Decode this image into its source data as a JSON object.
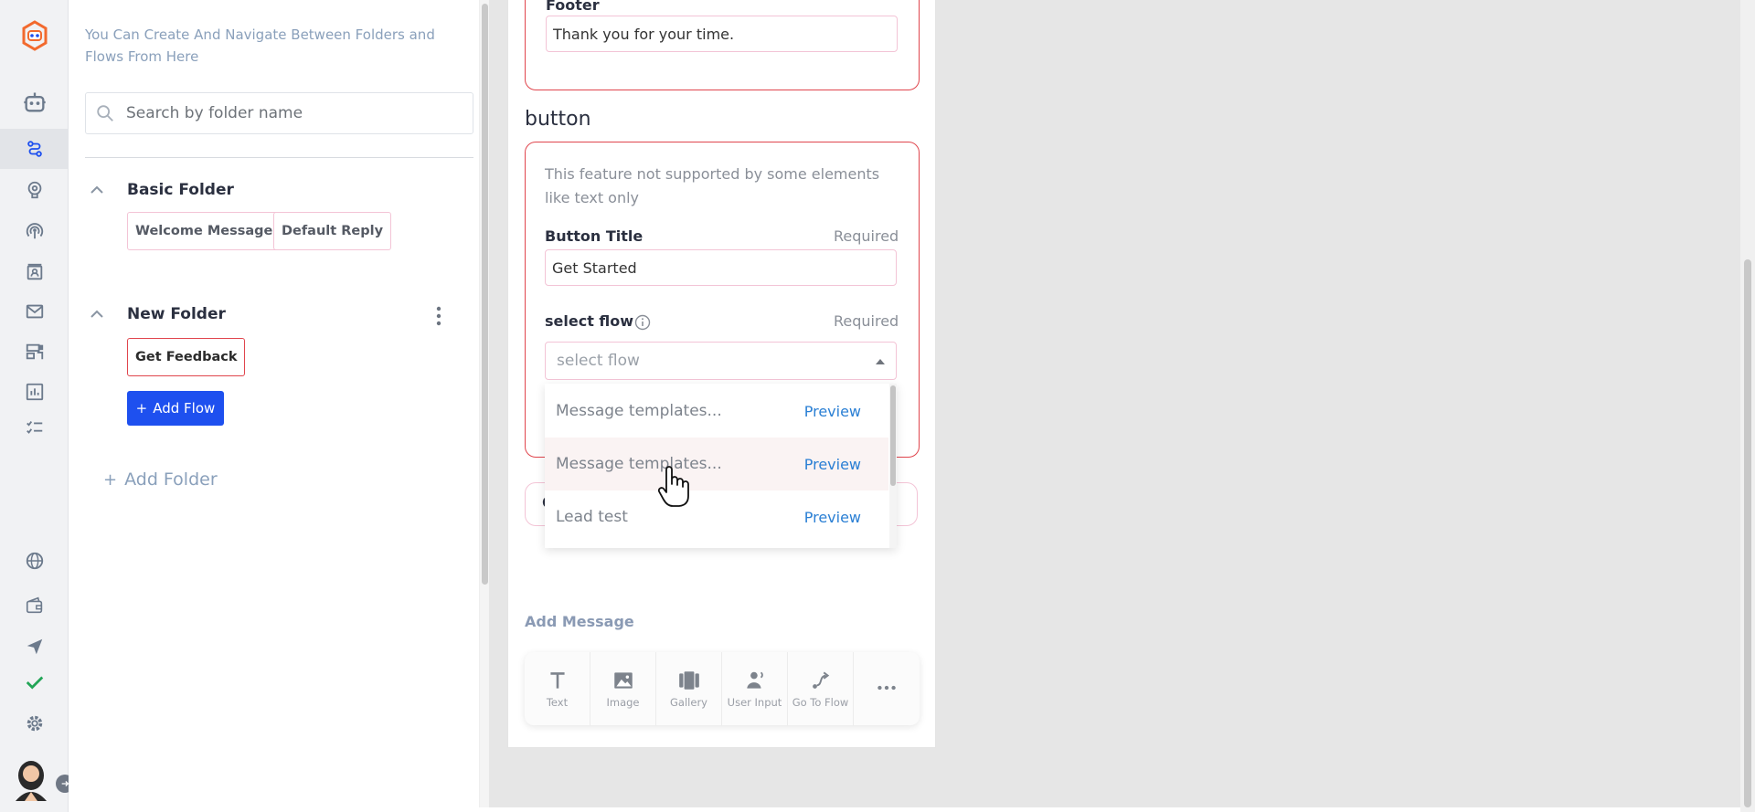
{
  "sidebar": {
    "icons": [
      "app-logo",
      "bot-icon",
      "flows-icon",
      "brain-icon",
      "broadcast-icon",
      "contacts-icon",
      "mail-icon",
      "templates-icon",
      "analytics-icon",
      "checklist-icon",
      "globe-icon",
      "wallet-icon",
      "send-icon",
      "check-icon",
      "settings-icon"
    ],
    "active": "flows-icon"
  },
  "folders": {
    "hint": "You Can Create And Navigate Between Folders and Flows From Here",
    "search_placeholder": "Search by folder name",
    "list": [
      {
        "name": "Basic Folder",
        "flows": [
          "Welcome Message",
          "Default Reply"
        ]
      },
      {
        "name": "New Folder",
        "flows": [
          "Get Feedback"
        ],
        "selected_flow": "Get Feedback"
      }
    ],
    "add_flow_label": "Add Flow",
    "add_flow_plus": "+",
    "add_folder_label": "Add Folder",
    "add_folder_plus": "+"
  },
  "editor": {
    "footer_label": "Footer",
    "footer_value": "Thank you for your time.",
    "button_heading": "button",
    "button_note": "This feature not supported by some elements like text only",
    "button_title_label": "Button Title",
    "required_label": "Required",
    "button_title_value": "Get Started",
    "select_flow_label": "select flow",
    "select_flow_placeholder": "select flow",
    "dropdown_options": [
      {
        "name": "Message templates...",
        "action": "Preview"
      },
      {
        "name": "Message templates...",
        "action": "Preview"
      },
      {
        "name": "Lead test",
        "action": "Preview"
      }
    ],
    "hidden_behind_char": "C",
    "add_message_label": "Add Message",
    "toolbar": [
      {
        "icon": "text-icon",
        "label": "Text"
      },
      {
        "icon": "image-icon",
        "label": "Image"
      },
      {
        "icon": "gallery-icon",
        "label": "Gallery"
      },
      {
        "icon": "user-input-icon",
        "label": "User Input"
      },
      {
        "icon": "go-to-flow-icon",
        "label": "Go To Flow"
      },
      {
        "icon": "more-icon",
        "label": ""
      }
    ]
  },
  "colors": {
    "accent_red": "#e0454d",
    "primary_blue": "#1e50ef",
    "link_blue": "#2a7fd4",
    "pink_border": "#f3c4d6",
    "logo_orange": "#f26a2e"
  }
}
